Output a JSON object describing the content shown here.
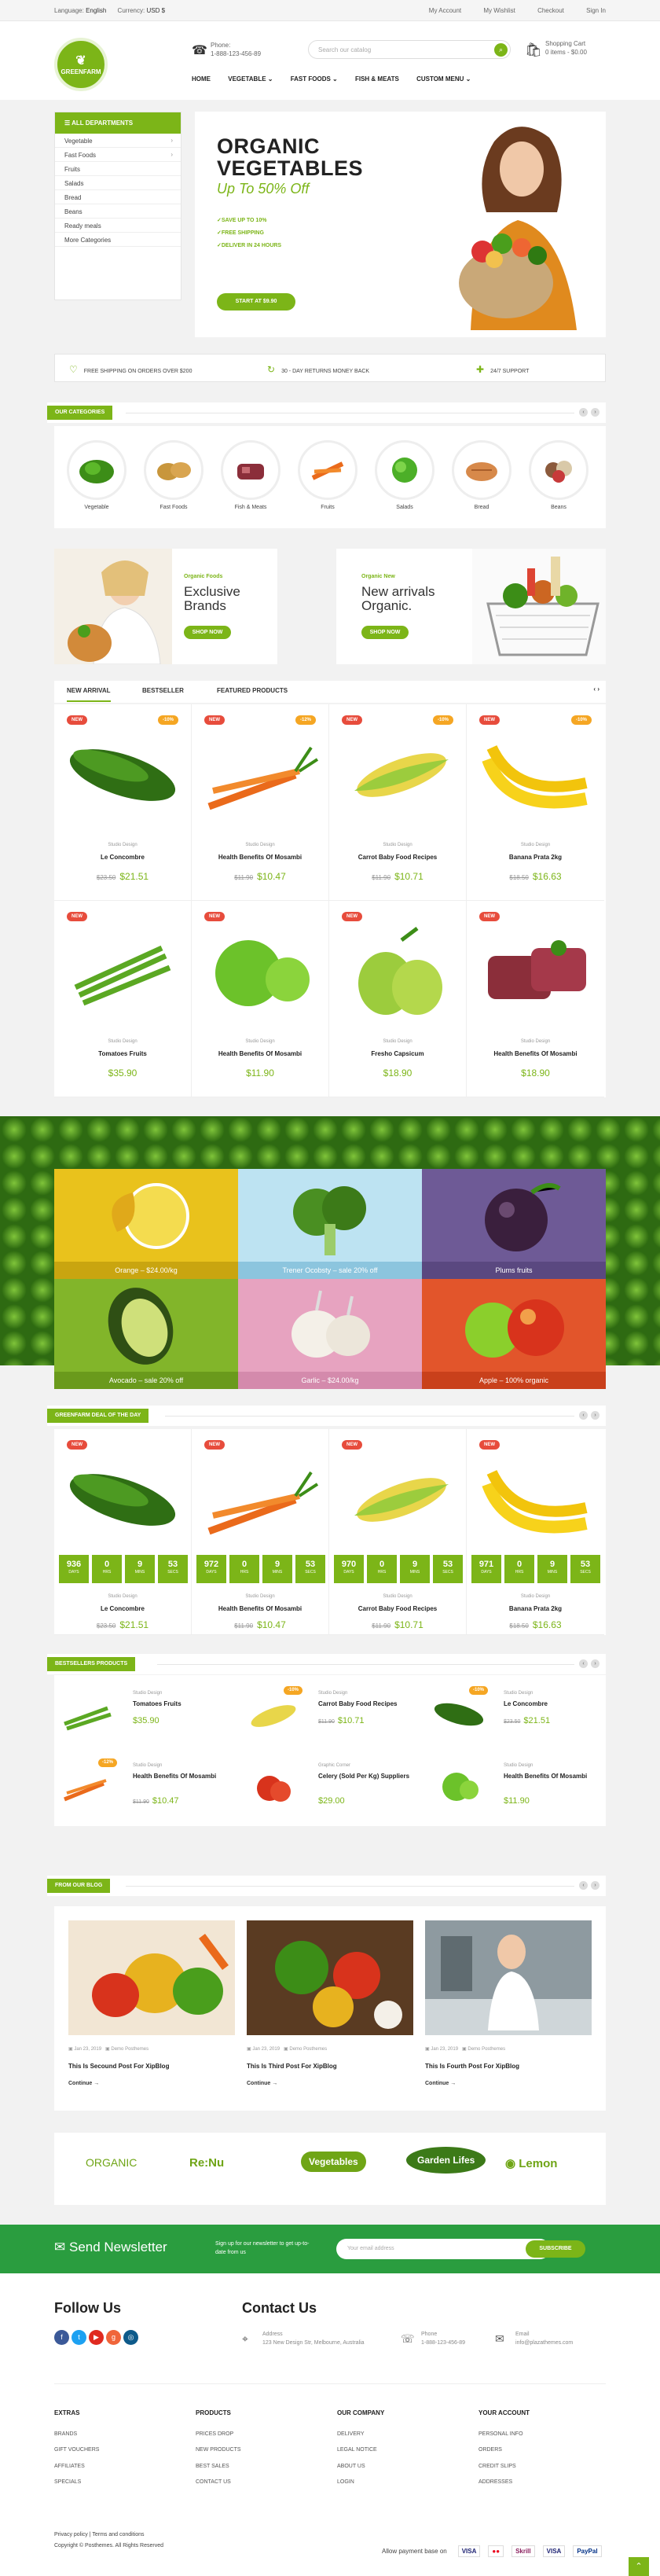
{
  "topbar": {
    "language_label": "Language:",
    "language": "English",
    "currency_label": "Currency:",
    "currency": "USD $",
    "links": [
      "My Account",
      "My Wishlist",
      "Checkout",
      "Sign In"
    ]
  },
  "header": {
    "logo": "GREENFARM",
    "phone_label": "Phone:",
    "phone": "1-888-123-456-89",
    "search_placeholder": "Search our catalog",
    "cart_label": "Shopping Cart",
    "cart_summary": "0 items - $0.00"
  },
  "nav": [
    "HOME",
    "VEGETABLE ⌄",
    "FAST FOODS ⌄",
    "FISH & MEATS",
    "CUSTOM MENU ⌄"
  ],
  "departments": {
    "title": "ALL DEPARTMENTS",
    "items": [
      {
        "label": "Vegetable",
        "arrow": true
      },
      {
        "label": "Fast Foods",
        "arrow": true
      },
      {
        "label": "Fruits"
      },
      {
        "label": "Salads"
      },
      {
        "label": "Bread"
      },
      {
        "label": "Beans"
      },
      {
        "label": "Ready meals"
      },
      {
        "label": "More Categories"
      }
    ]
  },
  "hero": {
    "title_1": "ORGANIC",
    "title_2": "VEGETABLES",
    "subtitle": "Up To 50% Off",
    "bullets": [
      "✓SAVE UP TO 10%",
      "✓FREE SHIPPING",
      "✓DELIVER IN 24 HOURS"
    ],
    "button": "START AT $9.90"
  },
  "features": [
    "FREE SHIPPING ON ORDERS OVER $200",
    "30 - DAY RETURNS MONEY BACK",
    "24/7 SUPPORT"
  ],
  "categories": {
    "title": "OUR CATEGORIES",
    "items": [
      "Vegetable",
      "Fast Foods",
      "Fish & Meats",
      "Fruits",
      "Salads",
      "Bread",
      "Beans"
    ]
  },
  "banners": [
    {
      "kicker": "Organic Foods",
      "title_1": "Exclusive",
      "title_2": "Brands",
      "button": "SHOP NOW"
    },
    {
      "kicker": "Organic New",
      "title_1": "New arrivals",
      "title_2": "Organic.",
      "button": "SHOP NOW"
    }
  ],
  "tabs": [
    "NEW ARRIVAL",
    "BESTSELLER",
    "FEATURED PRODUCTS"
  ],
  "products": [
    {
      "name": "Le Concombre",
      "vendor": "Studio Design",
      "old": "$23.50",
      "price": "$21.51",
      "new": "NEW",
      "sale": "-10%"
    },
    {
      "name": "Health Benefits Of Mosambi",
      "vendor": "Studio Design",
      "old": "$11.90",
      "price": "$10.47",
      "new": "NEW",
      "sale": "-12%"
    },
    {
      "name": "Carrot Baby Food Recipes",
      "vendor": "Studio Design",
      "old": "$11.90",
      "price": "$10.71",
      "new": "NEW",
      "sale": "-10%"
    },
    {
      "name": "Banana Prata 2kg",
      "vendor": "Studio Design",
      "old": "$18.50",
      "price": "$16.63",
      "new": "NEW",
      "sale": "-10%"
    },
    {
      "name": "Tomatoes Fruits",
      "vendor": "Studio Design",
      "old": "",
      "price": "$35.90",
      "new": "NEW",
      "sale": ""
    },
    {
      "name": "Health Benefits Of Mosambi",
      "vendor": "Studio Design",
      "old": "",
      "price": "$11.90",
      "new": "NEW",
      "sale": ""
    },
    {
      "name": "Fresho Capsicum",
      "vendor": "Studio Design",
      "old": "",
      "price": "$18.90",
      "new": "NEW",
      "sale": ""
    },
    {
      "name": "Health Benefits Of Mosambi",
      "vendor": "Studio Design",
      "old": "",
      "price": "$18.90",
      "new": "NEW",
      "sale": ""
    }
  ],
  "tiles": [
    "Orange – $24.00/kg",
    "Trener Ocobsty – sale 20% off",
    "Plums fruits",
    "Avocado – sale 20% off",
    "Garlic – $24.00/kg",
    "Apple – 100% organic"
  ],
  "deal": {
    "title": "GREENFARM DEAL OF THE DAY",
    "units": [
      "DAYS",
      "HRS",
      "MINS",
      "SECS"
    ],
    "items": [
      {
        "name": "Le Concombre",
        "vendor": "Studio Design",
        "old": "$23.50",
        "price": "$21.51",
        "days": "936",
        "hrs": "0",
        "mins": "9",
        "secs": "53",
        "new": "NEW"
      },
      {
        "name": "Health Benefits Of Mosambi",
        "vendor": "Studio Design",
        "old": "$11.90",
        "price": "$10.47",
        "days": "972",
        "hrs": "0",
        "mins": "9",
        "secs": "53",
        "new": "NEW"
      },
      {
        "name": "Carrot Baby Food Recipes",
        "vendor": "Studio Design",
        "old": "$11.90",
        "price": "$10.71",
        "days": "970",
        "hrs": "0",
        "mins": "9",
        "secs": "53",
        "new": "NEW"
      },
      {
        "name": "Banana Prata 2kg",
        "vendor": "Studio Design",
        "old": "$18.50",
        "price": "$16.63",
        "days": "971",
        "hrs": "0",
        "mins": "9",
        "secs": "53",
        "new": "NEW"
      }
    ]
  },
  "bestsellers": {
    "title": "BESTSELLERS PRODUCTS",
    "items": [
      {
        "vendor": "Studio Design",
        "name": "Tomatoes Fruits",
        "old": "",
        "price": "$35.90",
        "sale": ""
      },
      {
        "vendor": "Studio Design",
        "name": "Carrot Baby Food Recipes",
        "old": "$11.90",
        "price": "$10.71",
        "sale": "-10%"
      },
      {
        "vendor": "Studio Design",
        "name": "Le Concombre",
        "old": "$23.50",
        "price": "$21.51",
        "sale": "-10%"
      },
      {
        "vendor": "Studio Design",
        "name": "Health Benefits Of Mosambi",
        "old": "$11.90",
        "price": "$10.47",
        "sale": "-12%"
      },
      {
        "vendor": "Graphic Corner",
        "name": "Celery (Sold Per Kg) Suppliers",
        "old": "",
        "price": "$29.00",
        "sale": ""
      },
      {
        "vendor": "Studio Design",
        "name": "Health Benefits Of Mosambi",
        "old": "",
        "price": "$11.90",
        "sale": ""
      }
    ]
  },
  "blog": {
    "title": "FROM OUR BLOG",
    "posts": [
      {
        "date": "Jan 23, 2019",
        "author": "Demo Posthemes",
        "title": "This Is Secound Post For XipBlog",
        "more": "Continue →"
      },
      {
        "date": "Jan 23, 2019",
        "author": "Demo Posthemes",
        "title": "This Is Third Post For XipBlog",
        "more": "Continue →"
      },
      {
        "date": "Jan 23, 2019",
        "author": "Demo Posthemes",
        "title": "This Is Fourth Post For XipBlog",
        "more": "Continue →"
      }
    ]
  },
  "brands": [
    "ORGANIC",
    "Re:Nu",
    "Vegetables",
    "Garden Lifes",
    "Lemon"
  ],
  "newsletter": {
    "title": "Send Newsletter",
    "text": "Sign up for our newsletter to get up-to-date from us",
    "placeholder": "Your email address",
    "button": "SUBSCRIBE"
  },
  "footer": {
    "follow": "Follow Us",
    "contact": "Contact Us",
    "address_label": "Address",
    "address": "123 New Design Str, Melbourne, Australia",
    "phone_label": "Phone",
    "phone": "1-888-123-456-89",
    "email_label": "Email",
    "email": "info@plazathemes.com",
    "columns": [
      {
        "title": "EXTRAS",
        "links": [
          "BRANDS",
          "GIFT VOUCHERS",
          "AFFILIATES",
          "SPECIALS"
        ]
      },
      {
        "title": "PRODUCTS",
        "links": [
          "PRICES DROP",
          "NEW PRODUCTS",
          "BEST SALES",
          "CONTACT US"
        ]
      },
      {
        "title": "OUR COMPANY",
        "links": [
          "DELIVERY",
          "LEGAL NOTICE",
          "ABOUT US",
          "LOGIN"
        ]
      },
      {
        "title": "YOUR ACCOUNT",
        "links": [
          "PERSONAL INFO",
          "ORDERS",
          "CREDIT SLIPS",
          "ADDRESSES"
        ]
      }
    ],
    "privacy": "Privacy policy | Terms and conditions",
    "copyright": "Copyright © Posthemes. All Rights Reserved",
    "payment_label": "Allow payment base on",
    "payments": [
      "VISA",
      "●●",
      "Skrill",
      "VISA",
      "PayPal"
    ]
  },
  "colors": {
    "accent": "#7cb518",
    "newsletter": "#2a9d3f",
    "new_badge": "#e74c3c",
    "sale_badge": "#f5a623"
  }
}
